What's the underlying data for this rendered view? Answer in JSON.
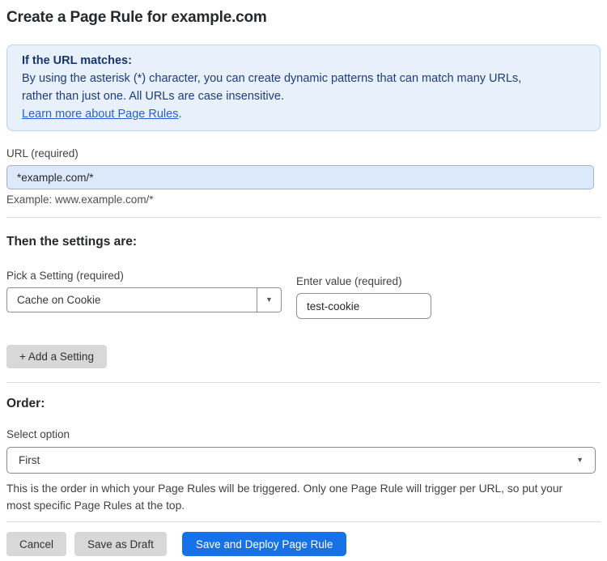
{
  "page": {
    "title": "Create a Page Rule for example.com"
  },
  "info_box": {
    "heading": "If the URL matches:",
    "lines": [
      "By using the asterisk (*) character, you can create dynamic patterns that can match many URLs,",
      "rather than just one. All URLs are case insensitive."
    ],
    "link_label": "Learn more about Page Rules",
    "link_suffix": "."
  },
  "url_field": {
    "label": "URL (required)",
    "value": "*example.com/*",
    "helper": "Example: www.example.com/*"
  },
  "settings_section": {
    "heading": "Then the settings are:",
    "setting_picker": {
      "label": "Pick a Setting (required)",
      "selected_value": "Cache on Cookie"
    },
    "value_field": {
      "label": "Enter value (required)",
      "value": "test-cookie"
    },
    "add_setting_label": "+ Add a Setting"
  },
  "order_section": {
    "heading": "Order:",
    "select_label": "Select option",
    "selected_value": "First",
    "helper_lines": [
      "This is the order in which your Page Rules will be triggered. Only one Page Rule will trigger per URL, so put your",
      "most specific Page Rules at the top."
    ]
  },
  "footer": {
    "cancel_label": "Cancel",
    "save_draft_label": "Save as Draft",
    "save_deploy_label": "Save and Deploy Page Rule"
  },
  "icons": {
    "dropdown_caret": "▼"
  },
  "colors": {
    "info_box_bg": "#e8f1fb",
    "info_box_border": "#b9d5f2",
    "info_text": "#1e3c78",
    "link_blue": "#2a5fcb",
    "url_input_bg": "#dbe9fa",
    "primary_button_bg": "#1672e6",
    "secondary_button_bg": "#d8d8d8",
    "divider": "#dcdcdc"
  }
}
